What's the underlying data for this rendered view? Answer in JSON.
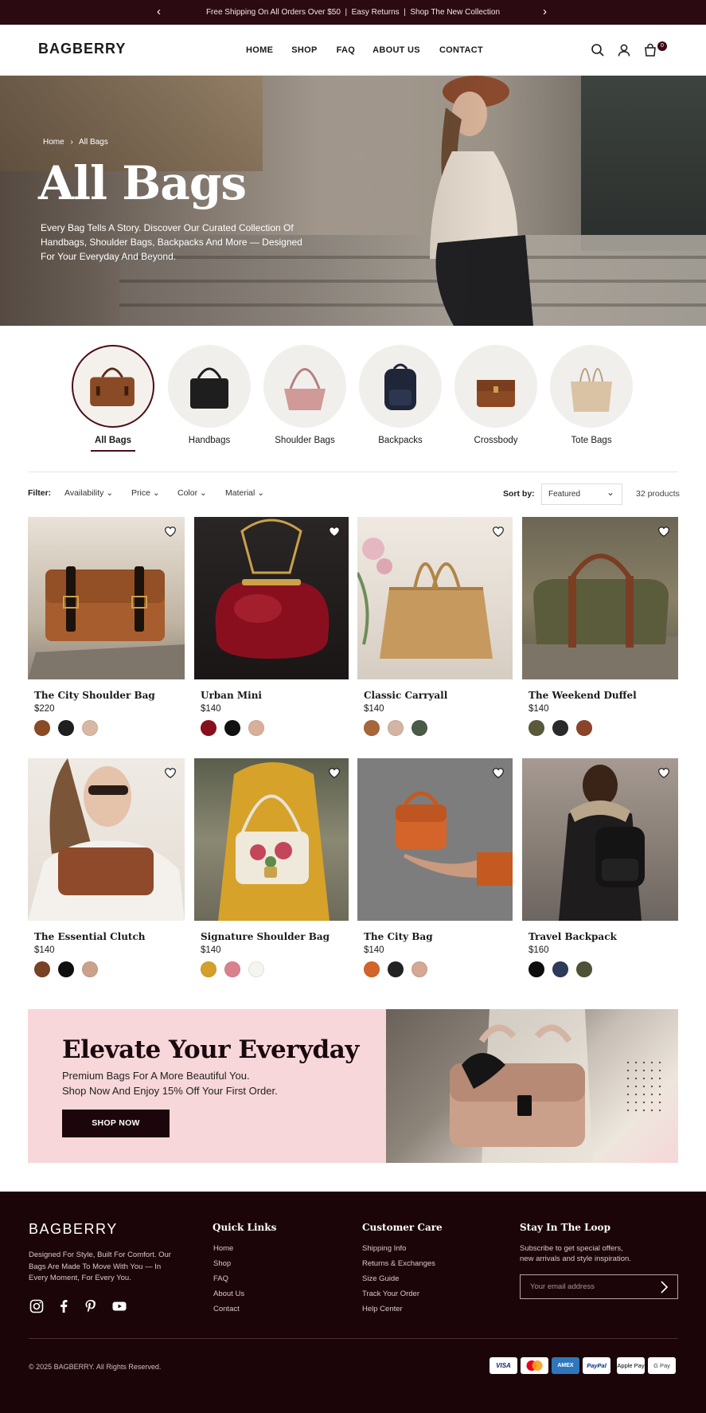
{
  "announcement": {
    "text": "Free Shipping On All Orders Over $50  |  Easy Returns  |  Shop The New Collection",
    "prev": "‹",
    "next": "›"
  },
  "header": {
    "logo": "BAGBERRY",
    "nav": [
      "HOME",
      "SHOP",
      "FAQ",
      "ABOUT US",
      "CONTACT"
    ],
    "cart_count": "0",
    "icons": [
      "search-icon",
      "account-icon",
      "cart-icon"
    ]
  },
  "hero": {
    "breadcrumb": {
      "home": "Home",
      "sep": "›",
      "current": "All Bags"
    },
    "title": "All Bags",
    "description": "Every Bag Tells A Story. Discover Our Curated Collection Of Handbags, Shoulder Bags, Backpacks And More — Designed For Your Everyday And Beyond."
  },
  "categories": [
    {
      "label": "All Bags",
      "selected": true
    },
    {
      "label": "Handbags",
      "selected": false
    },
    {
      "label": "Shoulder Bags",
      "selected": false
    },
    {
      "label": "Backpacks",
      "selected": false
    },
    {
      "label": "Crossbody",
      "selected": false
    },
    {
      "label": "Tote Bags",
      "selected": false
    }
  ],
  "filters": {
    "label": "Filter:",
    "options": [
      "Availability",
      "Price",
      "Color",
      "Material"
    ],
    "sort_label": "Sort by:",
    "sort_value": "Featured",
    "count": "32 products"
  },
  "products": [
    {
      "name": "The City Shoulder Bag",
      "price": "$220",
      "swatches": [
        "#8a4a25",
        "#1f1f1f",
        "#d8b8a5"
      ]
    },
    {
      "name": "Urban Mini",
      "price": "$140",
      "swatches": [
        "#8a0f1e",
        "#111111",
        "#d8b09a"
      ]
    },
    {
      "name": "Classic Carryall",
      "price": "$140",
      "swatches": [
        "#a8673a",
        "#d4b4a2",
        "#4a5a46"
      ]
    },
    {
      "name": "The Weekend Duffel",
      "price": "$140",
      "swatches": [
        "#5a5a3a",
        "#2a2a2a",
        "#8a4428"
      ]
    },
    {
      "name": "The Essential Clutch",
      "price": "$140",
      "swatches": [
        "#7a4224",
        "#0f0f0f",
        "#caa28c"
      ]
    },
    {
      "name": "Signature Shoulder Bag",
      "price": "$140",
      "swatches": [
        "#d4a02a",
        "#d9828e",
        "#f6f4ee"
      ]
    },
    {
      "name": "The City Bag",
      "price": "$140",
      "swatches": [
        "#d4642a",
        "#222222",
        "#d4a894"
      ]
    },
    {
      "name": "Travel Backpack",
      "price": "$160",
      "swatches": [
        "#0d0d0d",
        "#2e3a5a",
        "#4e5236"
      ]
    }
  ],
  "promo": {
    "title": "Elevate Your Everyday",
    "line1": "Premium Bags For A More Beautiful You.",
    "line2": "Shop Now And Enjoy 15% Off Your First Order.",
    "button": "SHOP NOW"
  },
  "footer": {
    "logo": "BAGBERRY",
    "description": "Designed For Style, Built For Comfort. Our Bags Are Made To Move With You — In Every Moment, For Every You.",
    "quick_links_title": "Quick Links",
    "quick_links": [
      "Home",
      "Shop",
      "FAQ",
      "About Us",
      "Contact"
    ],
    "care_title": "Customer Care",
    "care_links": [
      "Shipping Info",
      "Returns & Exchanges",
      "Size Guide",
      "Track Your Order",
      "Help Center"
    ],
    "newsletter_title": "Stay In The Loop",
    "newsletter_line1": "Subscribe to get special offers,",
    "newsletter_line2": "new arrivals and style inspiration.",
    "email_placeholder": "Your email address",
    "copyright": "© 2025 BAGBERRY. All Rights Reserved.",
    "payments": [
      "VISA",
      "Mastercard",
      "AMEX",
      "PayPal",
      "Apple Pay",
      "G Pay"
    ],
    "social": [
      "instagram-icon",
      "facebook-icon",
      "pinterest-icon",
      "youtube-icon"
    ]
  }
}
